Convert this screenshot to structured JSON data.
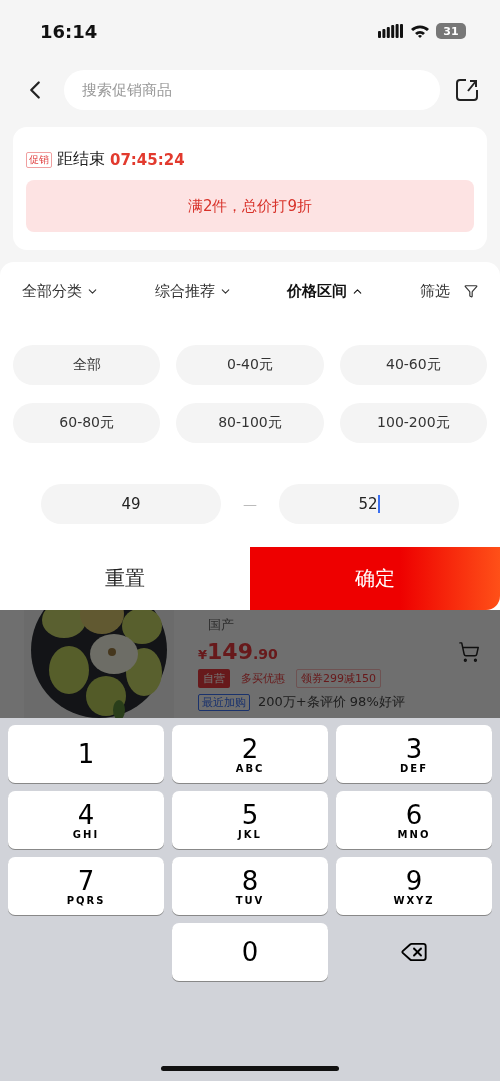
{
  "status_bar": {
    "time": "16:14",
    "battery": "31"
  },
  "header": {
    "search": {
      "placeholder": "搜索促销商品"
    }
  },
  "promo": {
    "tag": "促销",
    "countdown_label": "距结束",
    "countdown": "07:45:24",
    "rule": "满2件，总价打9折"
  },
  "filter_tabs": [
    {
      "label": "全部分类",
      "kind": "dropdown",
      "expanded": false
    },
    {
      "label": "综合推荐",
      "kind": "dropdown",
      "expanded": false
    },
    {
      "label": "价格区间",
      "kind": "dropdown",
      "expanded": true
    },
    {
      "label": "筛选",
      "kind": "filter",
      "expanded": false
    }
  ],
  "price_options": [
    {
      "label": "全部",
      "selected": false
    },
    {
      "label": "0-40元",
      "selected": false
    },
    {
      "label": "40-60元",
      "selected": false
    },
    {
      "label": "60-80元",
      "selected": false
    },
    {
      "label": "80-100元",
      "selected": false
    },
    {
      "label": "100-200元",
      "selected": false
    }
  ],
  "price_range": {
    "min": {
      "value": "49",
      "focused": false
    },
    "separator": "—",
    "max": {
      "value": "52",
      "focused": true
    }
  },
  "buttons": [
    {
      "label": "重置",
      "kind": "secondary"
    },
    {
      "label": "确定",
      "kind": "primary"
    }
  ],
  "product": {
    "kind": "picture",
    "origin": "国产",
    "price_symbol": "¥",
    "price_main": "149",
    "price_decimal": ".90",
    "tags": [
      {
        "label": "自营",
        "kind": "solid"
      },
      {
        "label": "多买优惠",
        "kind": "plain"
      },
      {
        "label": "领券299减150",
        "kind": "outline"
      }
    ],
    "badge": "最近加购",
    "reviews": "200万+条评价  98%好评"
  },
  "keyboard": [
    [
      {
        "kind": "digit",
        "digit": "1"
      },
      {
        "kind": "digit",
        "digit": "2",
        "letters": "ABC"
      },
      {
        "kind": "digit",
        "digit": "3",
        "letters": "DEF"
      }
    ],
    [
      {
        "kind": "digit",
        "digit": "4",
        "letters": "GHI"
      },
      {
        "kind": "digit",
        "digit": "5",
        "letters": "JKL"
      },
      {
        "kind": "digit",
        "digit": "6",
        "letters": "MNO"
      }
    ],
    [
      {
        "kind": "digit",
        "digit": "7",
        "letters": "PQRS"
      },
      {
        "kind": "digit",
        "digit": "8",
        "letters": "TUV"
      },
      {
        "kind": "digit",
        "digit": "9",
        "letters": "WXYZ"
      }
    ],
    [
      {
        "kind": "empty"
      },
      {
        "kind": "digit",
        "digit": "0"
      },
      {
        "kind": "delete"
      }
    ]
  ]
}
